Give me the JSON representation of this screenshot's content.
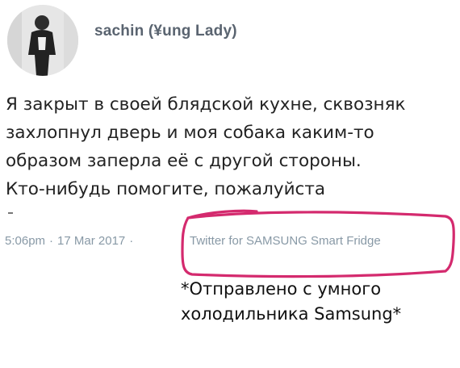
{
  "author": {
    "display_name": "sachin (¥ung Lady)"
  },
  "tweet": {
    "lines": [
      "Я закрыт в своей блядской кухне, сквозняк",
      "захлопнул дверь и моя собака каким-то",
      "образом заперла её с другой стороны.",
      "Кто-нибудь помогите, пожалуйста"
    ],
    "time": "5:06pm",
    "date": "17 Mar 2017",
    "separator": "·",
    "source": "Twitter for SAMSUNG Smart Fridge"
  },
  "caption": {
    "lines": [
      "*Отправлено с умного",
      "холодильника Samsung*"
    ]
  },
  "colors": {
    "highlight_circle": "#d42a6e",
    "meta_text": "#8899a6",
    "username_text": "#5a6470"
  }
}
